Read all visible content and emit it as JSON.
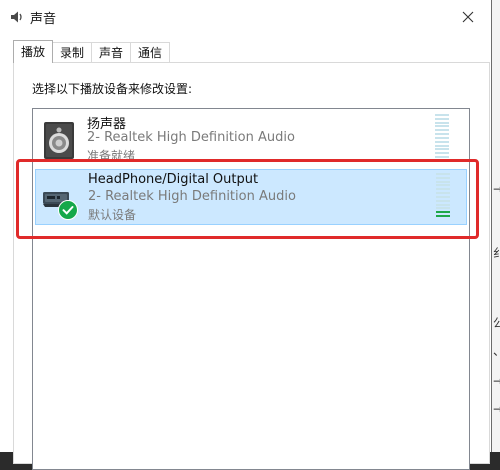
{
  "window": {
    "title": "声音",
    "app_icon": "speaker-icon",
    "close_icon": "close-icon"
  },
  "tabs": [
    {
      "label": "播放",
      "active": true
    },
    {
      "label": "录制",
      "active": false
    },
    {
      "label": "声音",
      "active": false
    },
    {
      "label": "通信",
      "active": false
    }
  ],
  "playback": {
    "instruction": "选择以下播放设备来修改设置:",
    "devices": [
      {
        "name": "扬声器",
        "description": "2- Realtek High Definition Audio",
        "status": "准备就绪",
        "icon": "speaker-device-icon",
        "selected": false,
        "level": 0
      },
      {
        "name": "HeadPhone/Digital Output",
        "description": "2- Realtek High Definition Audio",
        "status": "默认设备",
        "icon": "headphone-output-device-icon",
        "default_badge_icon": "green-check-icon",
        "selected": true,
        "level": 0.2
      }
    ]
  },
  "background_window": {
    "visible_chars": [
      "→",
      "纟",
      "公",
      "、",
      "→",
      "→"
    ]
  },
  "colors": {
    "selection_bg": "#cce8ff",
    "selection_border": "#99d1ff",
    "annotation_red": "#e02a2a",
    "meter_on": "#1ea84a",
    "meter_off": "#c8e3ec"
  }
}
